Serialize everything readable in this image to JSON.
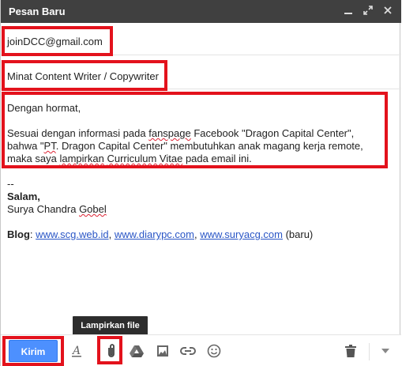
{
  "window": {
    "title": "Pesan Baru",
    "controls": [
      "minimize-icon",
      "expand-icon",
      "close-icon"
    ]
  },
  "to": {
    "value": "joinDCC@gmail.com"
  },
  "subject": {
    "value": "Minat Content Writer / Copywriter"
  },
  "message": {
    "greeting": "Dengan hormat,",
    "paragraph": {
      "p1": "Sesuai dengan informasi pada ",
      "fanspage": "fanspage",
      "p2": " Facebook \"Dragon Capital Center\", bahwa \"",
      "pt": "PT",
      "p3": ". Dragon Capital Center\" membutuhkan anak magang kerja remote, maka saya ",
      "lampirkan": "lampirkan",
      "p4": " ",
      "curriculum": "Curriculum Vitae",
      "p5": " pada email ini."
    },
    "sig_dashes": "--",
    "closing": "Salam,",
    "name_first": "Surya Chandra ",
    "name_last": "Gobel",
    "blog_label": "Blog",
    "blog_sep": ": ",
    "links": [
      "www.scg.web.id",
      "www.diarypc.com",
      "www.suryacg.com"
    ],
    "link_sep": ", ",
    "blog_suffix": " (baru)"
  },
  "tooltip": {
    "text": "Lampirkan file"
  },
  "toolbar": {
    "send_label": "Kirim",
    "icons": [
      "format-text-icon",
      "attach-file-icon",
      "google-drive-icon",
      "insert-photo-icon",
      "insert-link-icon",
      "insert-emoji-icon",
      "trash-icon",
      "more-options-icon"
    ]
  },
  "colors": {
    "titlebar": "#404040",
    "send_button": "#4d90fe",
    "highlight": "#e3121c",
    "link": "#2a56c6"
  }
}
